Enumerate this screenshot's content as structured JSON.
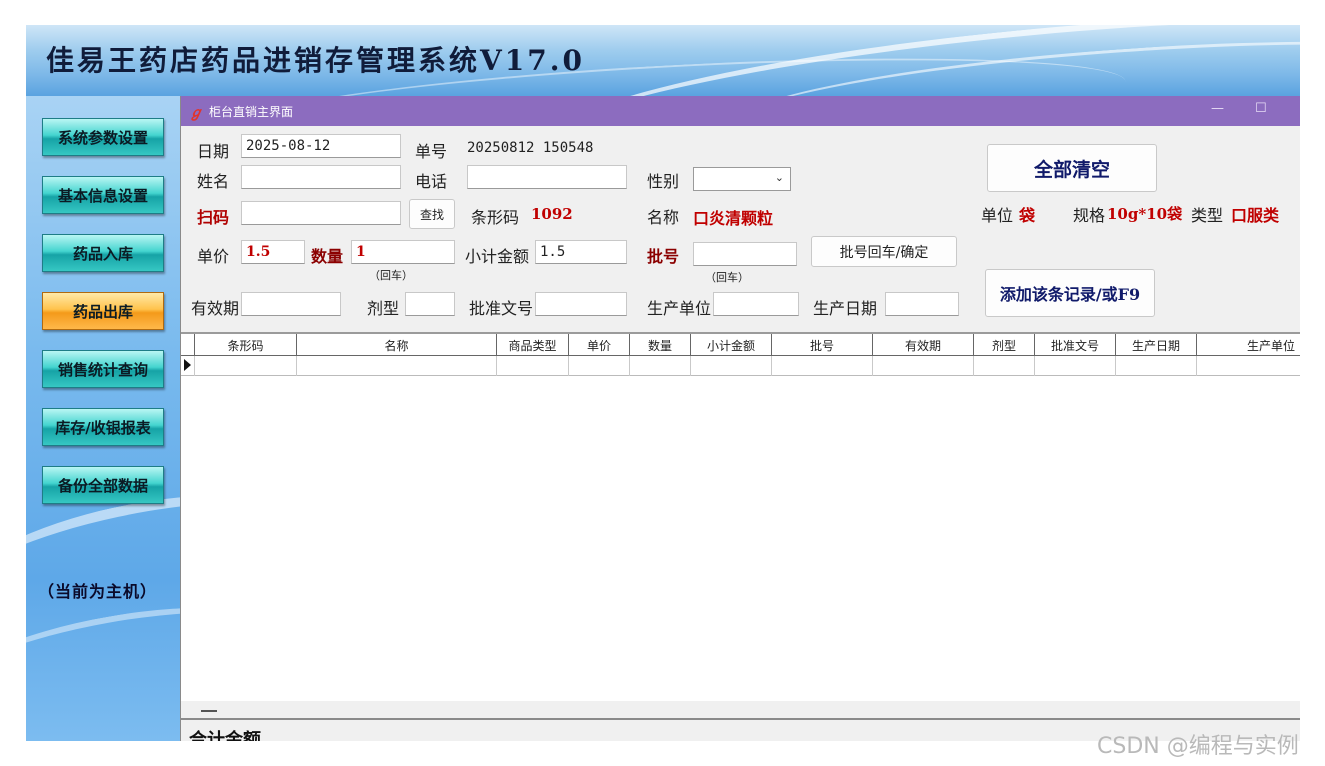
{
  "app": {
    "title": "佳易王药店药品进销存管理系统V17.0"
  },
  "sidebar": {
    "items": [
      {
        "label": "系统参数设置"
      },
      {
        "label": "基本信息设置"
      },
      {
        "label": "药品入库"
      },
      {
        "label": "药品出库",
        "active": true
      },
      {
        "label": "销售统计查询"
      },
      {
        "label": "库存/收银报表"
      },
      {
        "label": "备份全部数据"
      }
    ],
    "host_label": "（当前为主机）"
  },
  "window": {
    "title": "柜台直销主界面",
    "minimize": "—",
    "maximize": "☐"
  },
  "form": {
    "date_label": "日期",
    "date_value": "2025-08-12",
    "order_no_label": "单号",
    "order_no_value": "20250812 150548",
    "name_label": "姓名",
    "name_value": "",
    "phone_label": "电话",
    "phone_value": "",
    "gender_label": "性别",
    "gender_value": "",
    "scan_label": "扫码",
    "scan_value": "",
    "find_button": "查找",
    "barcode_label": "条形码",
    "barcode_value": "1092",
    "product_name_label": "名称",
    "product_name_value": "口炎清颗粒",
    "unit_label": "单位",
    "unit_value": "袋",
    "spec_label": "规格",
    "spec_value": "10g*10袋",
    "type_label": "类型",
    "type_value": "口服类",
    "price_label": "单价",
    "price_value": "1.5",
    "qty_label": "数量",
    "qty_value": "1",
    "qty_hint": "（回车）",
    "subtotal_label": "小计金额",
    "subtotal_value": "1.5",
    "batch_label": "批号",
    "batch_value": "",
    "batch_hint": "（回车）",
    "batch_confirm_button": "批号回车/确定",
    "clear_all_button": "全部清空",
    "add_record_button": "添加该条记录/或F9",
    "expiry_label": "有效期",
    "expiry_value": "",
    "dosage_label": "剂型",
    "dosage_value": "",
    "approval_label": "批准文号",
    "approval_value": "",
    "manufacturer_label": "生产单位",
    "manufacturer_value": "",
    "mfg_date_label": "生产日期",
    "mfg_date_value": ""
  },
  "table": {
    "columns": [
      "条形码",
      "名称",
      "商品类型",
      "单价",
      "数量",
      "小计金额",
      "批号",
      "有效期",
      "剂型",
      "批准文号",
      "生产日期",
      "生产单位"
    ],
    "rows": []
  },
  "footer": {
    "total_label": "合计金额"
  },
  "watermark": "CSDN @编程与实例"
}
